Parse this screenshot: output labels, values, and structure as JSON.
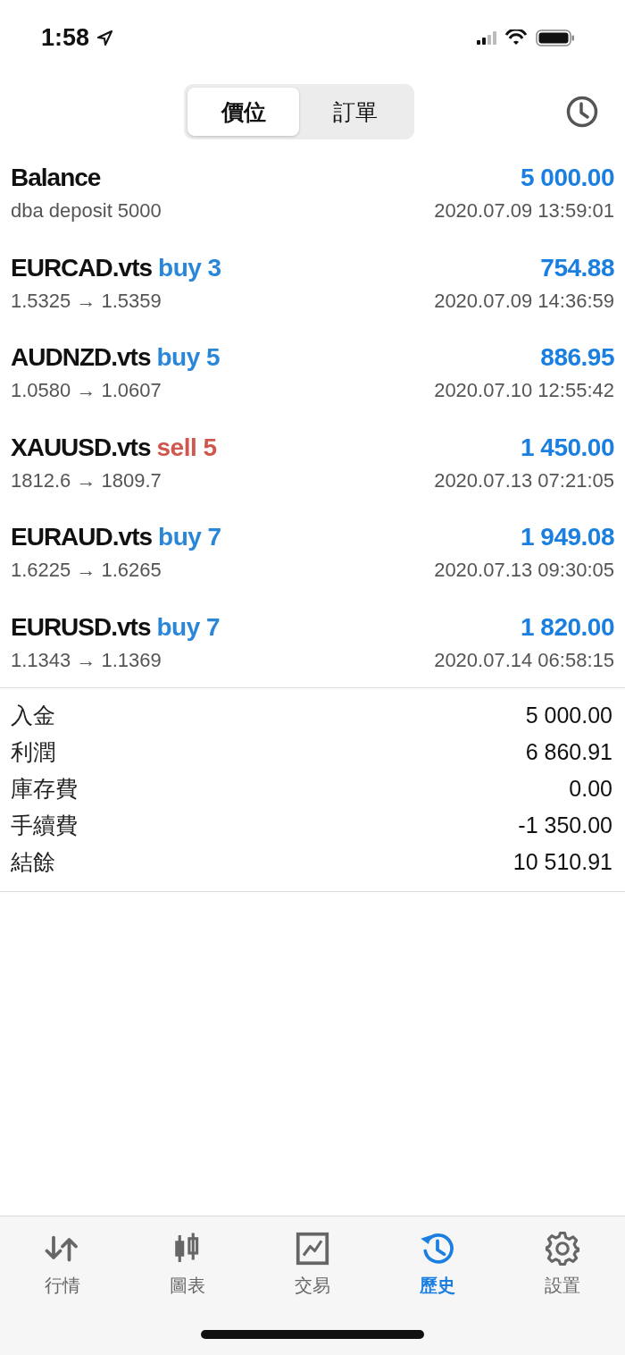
{
  "status_bar": {
    "time": "1:58"
  },
  "segments": [
    {
      "label": "價位",
      "selected": true
    },
    {
      "label": "訂單",
      "selected": false
    }
  ],
  "deals": [
    {
      "kind": "balance",
      "title": "Balance",
      "amount": "5 000.00",
      "detail": "dba deposit 5000",
      "time": "2020.07.09 13:59:01"
    },
    {
      "kind": "trade",
      "title": "EURCAD.vts",
      "color": "#2a86d8",
      "order": "buy 3",
      "amount": "754.88",
      "detail": "1.5325 → 1.5359",
      "time": "2020.07.09 14:36:59"
    },
    {
      "kind": "trade",
      "title": "AUDNZD.vts",
      "color": "#2a86d8",
      "order": "buy 5",
      "amount": "886.95",
      "detail": "1.0580 → 1.0607",
      "time": "2020.07.10 12:55:42"
    },
    {
      "kind": "trade",
      "title": "XAUUSD.vts",
      "color": "#d0574d",
      "order": "sell 5",
      "amount": "1 450.00",
      "detail": "1812.6 → 1809.7",
      "time": "2020.07.13 07:21:05"
    },
    {
      "kind": "trade",
      "title": "EURAUD.vts",
      "color": "#2a86d8",
      "order": "buy 7",
      "amount": "1 949.08",
      "detail": "1.6225 → 1.6265",
      "time": "2020.07.13 09:30:05"
    },
    {
      "kind": "trade",
      "title": "EURUSD.vts",
      "color": "#2a86d8",
      "order": "buy 7",
      "amount": "1 820.00",
      "detail": "1.1343 → 1.1369",
      "time": "2020.07.14 06:58:15"
    }
  ],
  "summary": [
    {
      "label": "入金",
      "value": "5 000.00"
    },
    {
      "label": "利潤",
      "value": "6 860.91"
    },
    {
      "label": "庫存費",
      "value": "0.00"
    },
    {
      "label": "手續費",
      "value": "-1 350.00"
    },
    {
      "label": "結餘",
      "value": "10 510.91"
    }
  ],
  "tab_bar": [
    {
      "label": "行情",
      "kind": "quotes",
      "selected": false
    },
    {
      "label": "圖表",
      "kind": "chart",
      "selected": false
    },
    {
      "label": "交易",
      "kind": "trade",
      "selected": false
    },
    {
      "label": "歷史",
      "kind": "history",
      "selected": true
    },
    {
      "label": "設置",
      "kind": "settings",
      "selected": false
    }
  ]
}
